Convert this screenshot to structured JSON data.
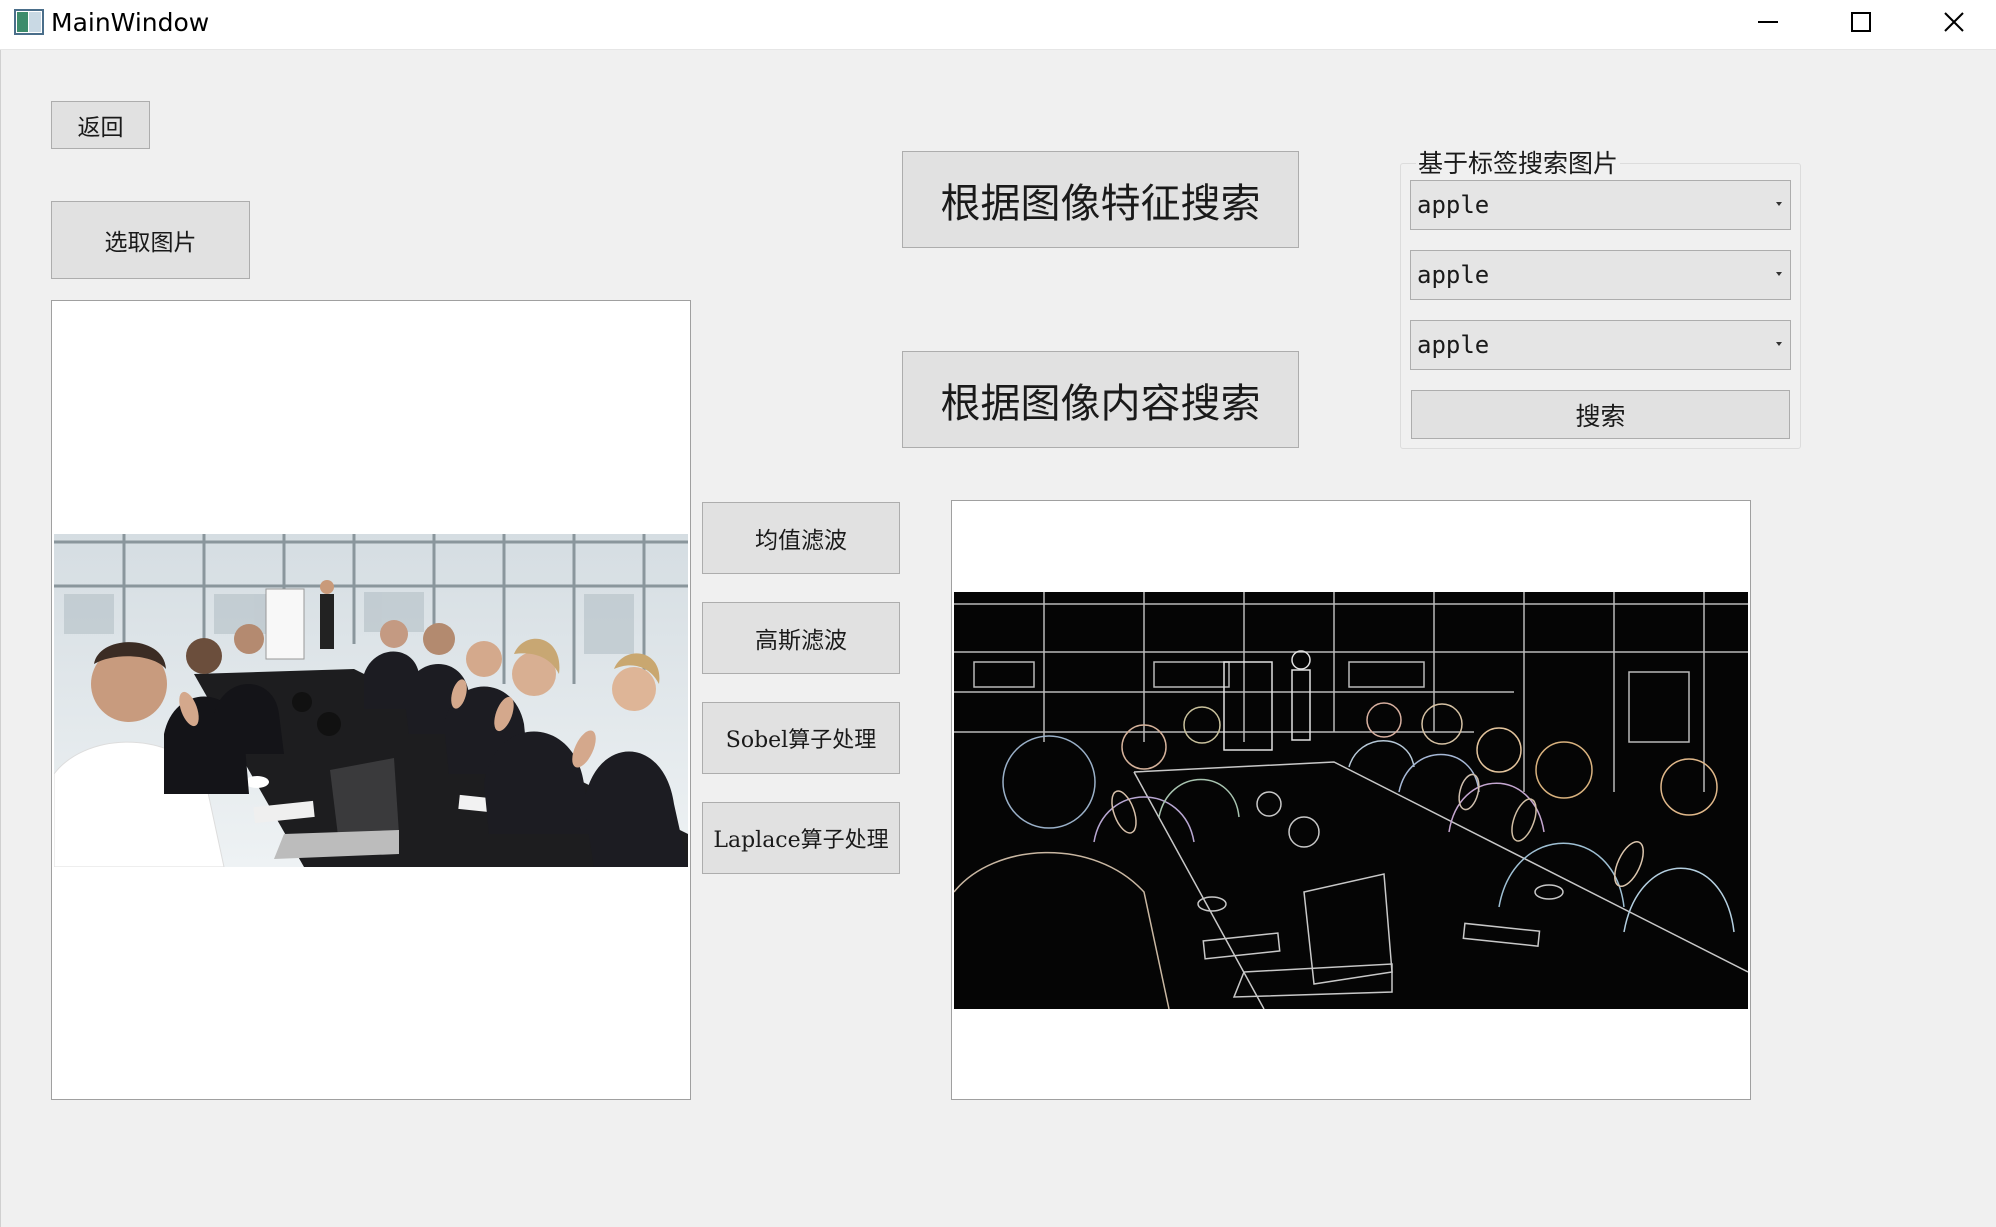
{
  "window": {
    "title": "MainWindow"
  },
  "buttons": {
    "back": "返回",
    "select_image": "选取图片",
    "search_by_feature": "根据图像特征搜索",
    "search_by_content": "根据图像内容搜索",
    "mean_filter": "均值滤波",
    "gaussian_filter": "高斯滤波",
    "sobel": "Sobel算子处理",
    "laplace": "Laplace算子处理"
  },
  "tag_search": {
    "title": "基于标签搜索图片",
    "combos": [
      {
        "value": "apple"
      },
      {
        "value": "apple"
      },
      {
        "value": "apple"
      }
    ],
    "search_button": "搜索"
  },
  "images": {
    "original": "conference-room-photo",
    "processed": "edge-detection-result"
  },
  "colors": {
    "window_bg": "#f0f0f0",
    "button_bg": "#e1e1e1",
    "button_border": "#adadad",
    "panel_bg": "#ffffff"
  }
}
